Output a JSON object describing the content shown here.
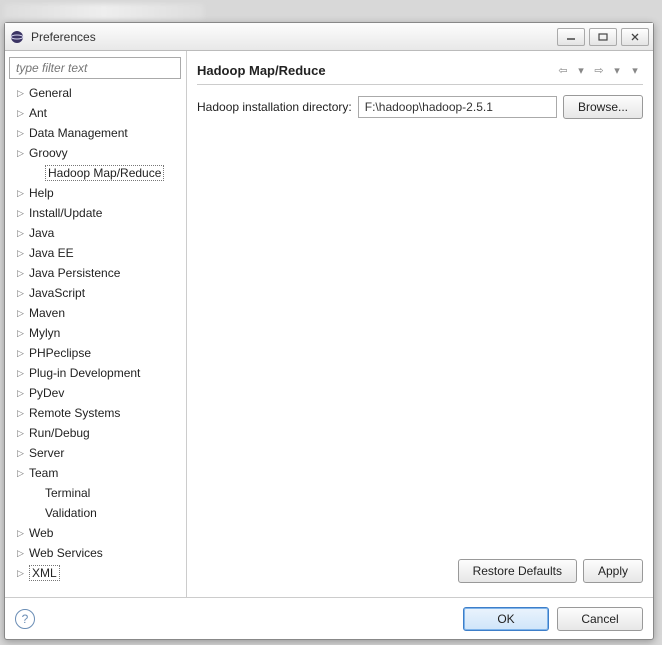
{
  "window": {
    "title": "Preferences"
  },
  "filter": {
    "placeholder": "type filter text"
  },
  "tree": [
    {
      "label": "General",
      "expandable": true
    },
    {
      "label": "Ant",
      "expandable": true
    },
    {
      "label": "Data Management",
      "expandable": true
    },
    {
      "label": "Groovy",
      "expandable": true
    },
    {
      "label": "Hadoop Map/Reduce",
      "expandable": false,
      "child": true,
      "selected": true
    },
    {
      "label": "Help",
      "expandable": true
    },
    {
      "label": "Install/Update",
      "expandable": true
    },
    {
      "label": "Java",
      "expandable": true
    },
    {
      "label": "Java EE",
      "expandable": true
    },
    {
      "label": "Java Persistence",
      "expandable": true
    },
    {
      "label": "JavaScript",
      "expandable": true
    },
    {
      "label": "Maven",
      "expandable": true
    },
    {
      "label": "Mylyn",
      "expandable": true
    },
    {
      "label": "PHPeclipse",
      "expandable": true
    },
    {
      "label": "Plug-in Development",
      "expandable": true
    },
    {
      "label": "PyDev",
      "expandable": true
    },
    {
      "label": "Remote Systems",
      "expandable": true
    },
    {
      "label": "Run/Debug",
      "expandable": true
    },
    {
      "label": "Server",
      "expandable": true
    },
    {
      "label": "Team",
      "expandable": true
    },
    {
      "label": "Terminal",
      "expandable": false,
      "child": true
    },
    {
      "label": "Validation",
      "expandable": false,
      "child": true
    },
    {
      "label": "Web",
      "expandable": true
    },
    {
      "label": "Web Services",
      "expandable": true
    },
    {
      "label": "XML",
      "expandable": true,
      "boxed": true
    }
  ],
  "main": {
    "title": "Hadoop Map/Reduce",
    "field_label": "Hadoop installation directory:",
    "field_value": "F:\\hadoop\\hadoop-2.5.1",
    "browse_label": "Browse...",
    "restore_label": "Restore Defaults",
    "apply_label": "Apply"
  },
  "footer": {
    "ok_label": "OK",
    "cancel_label": "Cancel"
  }
}
